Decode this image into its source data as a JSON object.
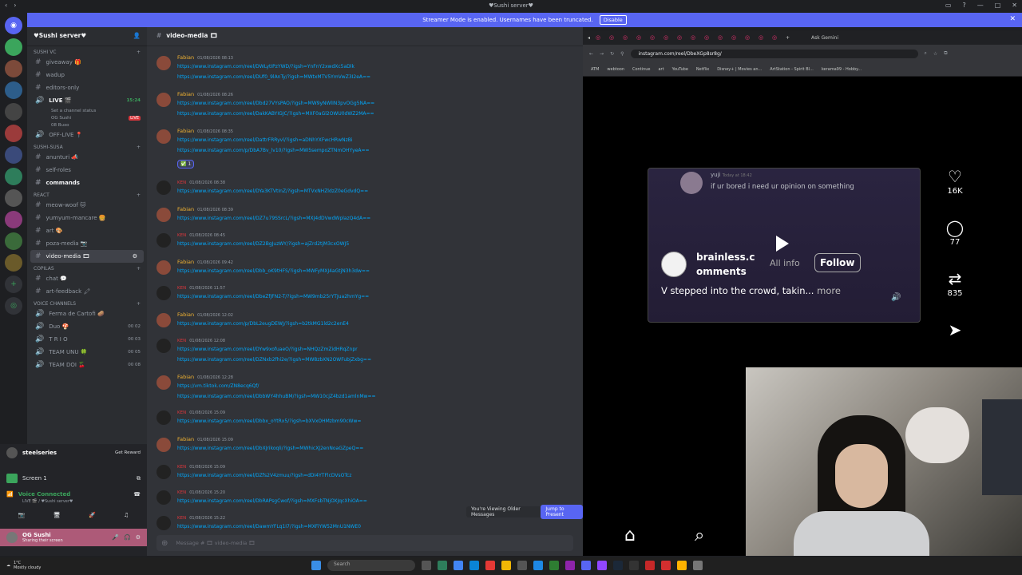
{
  "window": {
    "title": "♥Sushi server♥"
  },
  "banner": {
    "text": "Streamer Mode is enabled. Usernames have been truncated.",
    "disable_label": "Disable"
  },
  "server": {
    "name": "♥Sushi server♥"
  },
  "sidebar": {
    "categories": {
      "sushi_vc": "SUSHI VC",
      "sushi_susa": "SUSHI-SUSA",
      "react": "REACT",
      "copilas": "COPILAS",
      "voice": "Voice Channels"
    },
    "channels": {
      "giveaway": "giveaway 🎁",
      "wadup": "wadup",
      "editors_only": "editors-only",
      "live": "LIVE 🎬",
      "live_status": "Set a channel status",
      "live_user1": "OG Sushi",
      "live_user2": "08 Buxo",
      "live_time": "15:24",
      "live_badge": "LIVE",
      "off_live": "OFF-LIVE 📍",
      "anunturi": "anunturi 📣",
      "self_roles": "self-roles",
      "commands": "commands",
      "meow_woof": "meow-woof 🐱",
      "yumyum": "yumyum-mancare 🍔",
      "art": "art 🎨",
      "poza_media": "poza-media 📷",
      "video_media": "video-media 🎞",
      "chat": "chat 💬",
      "art_feedback": "art-feedback 🖍",
      "ferma": "Ferma de Cartofi 🥔",
      "duo": "Duo 🍄",
      "trio": "T R I O",
      "team_unu": "TEAM UNU 🍀",
      "team_doi": "TEAM DOI 🍒",
      "vc_count_duo": "00 02",
      "vc_count_trio": "00 03",
      "vc_count_unu": "00 05",
      "vc_count_doi": "00 08"
    }
  },
  "userpanel": {
    "steelseries": "steelseries",
    "get_reward": "Get Reward",
    "screen": "Screen 1",
    "voice_connected": "Voice Connected",
    "voice_sub": "LIVE 🎬 / ♥Sushi server♥",
    "username": "OG Sushi",
    "user_status": "Sharing their screen"
  },
  "chat": {
    "channel_title": "video-media 🎞",
    "messages": [
      {
        "author": "Fabian",
        "ts": "01/08/2026 08:13",
        "links": [
          "https://www.instagram.com/reel/DWLytIPzYWD/?igsh=YnFnY2xwdXc5aDlk",
          "https://www.instagram.com/reel/DUf0_9lAnTy/?igsh=MWtxMTV5YmVwZ3I2eA=="
        ]
      },
      {
        "author": "Fabian",
        "ts": "01/08/2026 08:26",
        "links": [
          "https://www.instagram.com/reel/Dbd27VYsPAO/?igsh=MW9yNWlIN3pvOGg5NA==",
          "https://www.instagram.com/reel/DakKABYIGJC/?igsh=MXF0aGl2OWU0dWZ2MA=="
        ]
      },
      {
        "author": "Fabian",
        "ts": "01/08/2026 08:35",
        "links": [
          "https://www.instagram.com/reel/DattrFRRyvl/?igsh=aDNhYXFwcHRwNzBi",
          "https://www.instagram.com/p/DbA7Bv_lv10/?igsh=MW5sempoZTNmOHYyeA=="
        ]
      },
      {
        "author": "KEN",
        "ts": "01/08/2026 08:38",
        "links": [
          "https://www.instagram.com/reel/DYa3KTVtInZ/?igsh=MTVxNHZldzZ0eGdvdQ=="
        ]
      },
      {
        "author": "Fabian",
        "ts": "01/08/2026 08:39",
        "links": [
          "https://www.instagram.com/reel/DZ7u79SSrcL/?igsh=MXJ4dDVwdWplazQ4dA=="
        ]
      },
      {
        "author": "KEN",
        "ts": "01/08/2026 08:45",
        "links": [
          "https://www.instagram.com/reel/DZ2BgJuzWY/?igsh=ajZrd2tjM3cxOWJ5"
        ]
      },
      {
        "author": "Fabian",
        "ts": "01/08/2026 09:42",
        "links": [
          "https://www.instagram.com/reel/Dbb_oK9tHFS/?igsh=MWFyMXJ4aGtjN3h3dw=="
        ]
      },
      {
        "author": "KEN",
        "ts": "01/08/2026 11:57",
        "links": [
          "https://www.instagram.com/reel/DbeZfJFN2-T/?igsh=MW9mb25rYTJua2hmYg=="
        ]
      },
      {
        "author": "Fabian",
        "ts": "01/08/2026 12:02",
        "links": [
          "https://www.instagram.com/p/DbL2eugDEWJ/?igsh=b2tkMG1ld2c2enE4"
        ]
      },
      {
        "author": "KEN",
        "ts": "01/08/2026 12:08",
        "links": [
          "https://www.instagram.com/reel/DYw9xofuaeO/?igsh=NHQzZmZidHRqZnpr",
          "https://www.instagram.com/reel/DZNxb2fhi2e/?igsh=MW8zbXN2OWFubjZxbg=="
        ]
      },
      {
        "author": "Fabian",
        "ts": "01/08/2026 12:28",
        "links": [
          "https://vm.tiktok.com/ZN8ecq6Qf/",
          "https://www.instagram.com/reel/DbbWY4hhuBM/?igsh=MW10cjZ4bzd1amlnMw=="
        ]
      },
      {
        "author": "KEN",
        "ts": "01/08/2026 15:09",
        "links": [
          "https://www.instagram.com/reel/Dbbx_oYtRx5/?igsh=bXVxOHMzbm90cWw="
        ]
      },
      {
        "author": "Fabian",
        "ts": "01/08/2026 15:09",
        "links": [
          "https://www.instagram.com/reel/DbXJrikoqli/?igsh=MWhicXJ2enNoaGZpeQ=="
        ]
      },
      {
        "author": "KEN",
        "ts": "01/08/2026 15:09",
        "links": [
          "https://www.instagram.com/reel/DZfs2V4zmuu/?igsh=dDI4YTFlcDVsOTcz"
        ]
      },
      {
        "author": "KEN",
        "ts": "01/08/2026 15:20",
        "links": [
          "https://www.instagram.com/reel/DbRAPsgCwof/?igsh=MXFsbTNjOXJqcXhiOA=="
        ]
      },
      {
        "author": "KEN",
        "ts": "01/08/2026 15:22",
        "links": [
          "https://www.instagram.com/reel/DawmYFLq1I7/?igsh=MXFiYW52MnU1NWE0"
        ]
      }
    ],
    "reaction": "✅ 1",
    "older_notice": "You're Viewing Older Messages",
    "jump_label": "Jump to Present",
    "composer_placeholder": "Message # 🎞 video-media 🎞"
  },
  "browser": {
    "url": "instagram.com/reel/DbeXGp8sr8g/",
    "ask_gemini": "Ask Gemini",
    "bookmarks": [
      "ATM",
      "webtoon",
      "Continue",
      "art",
      "YouTube",
      "Netflix",
      "Disney+ | Movies an...",
      "ArtStation - Spirit Bl...",
      "kerama99 - Hobby..."
    ]
  },
  "instagram": {
    "preview_user": "yuji",
    "preview_time": "Today at 18:42",
    "preview_msg": "if ur bored i need ur opinion on something",
    "handle": "brainless.comments",
    "info_label": "All info",
    "follow_label": "Follow",
    "caption": "V stepped into the crowd, takin...",
    "more_label": "more",
    "likes": "16K",
    "comments": "77",
    "reposts": "835"
  },
  "taskbar": {
    "temp": "1°C",
    "weather": "Mostly cloudy",
    "search": "Search"
  }
}
